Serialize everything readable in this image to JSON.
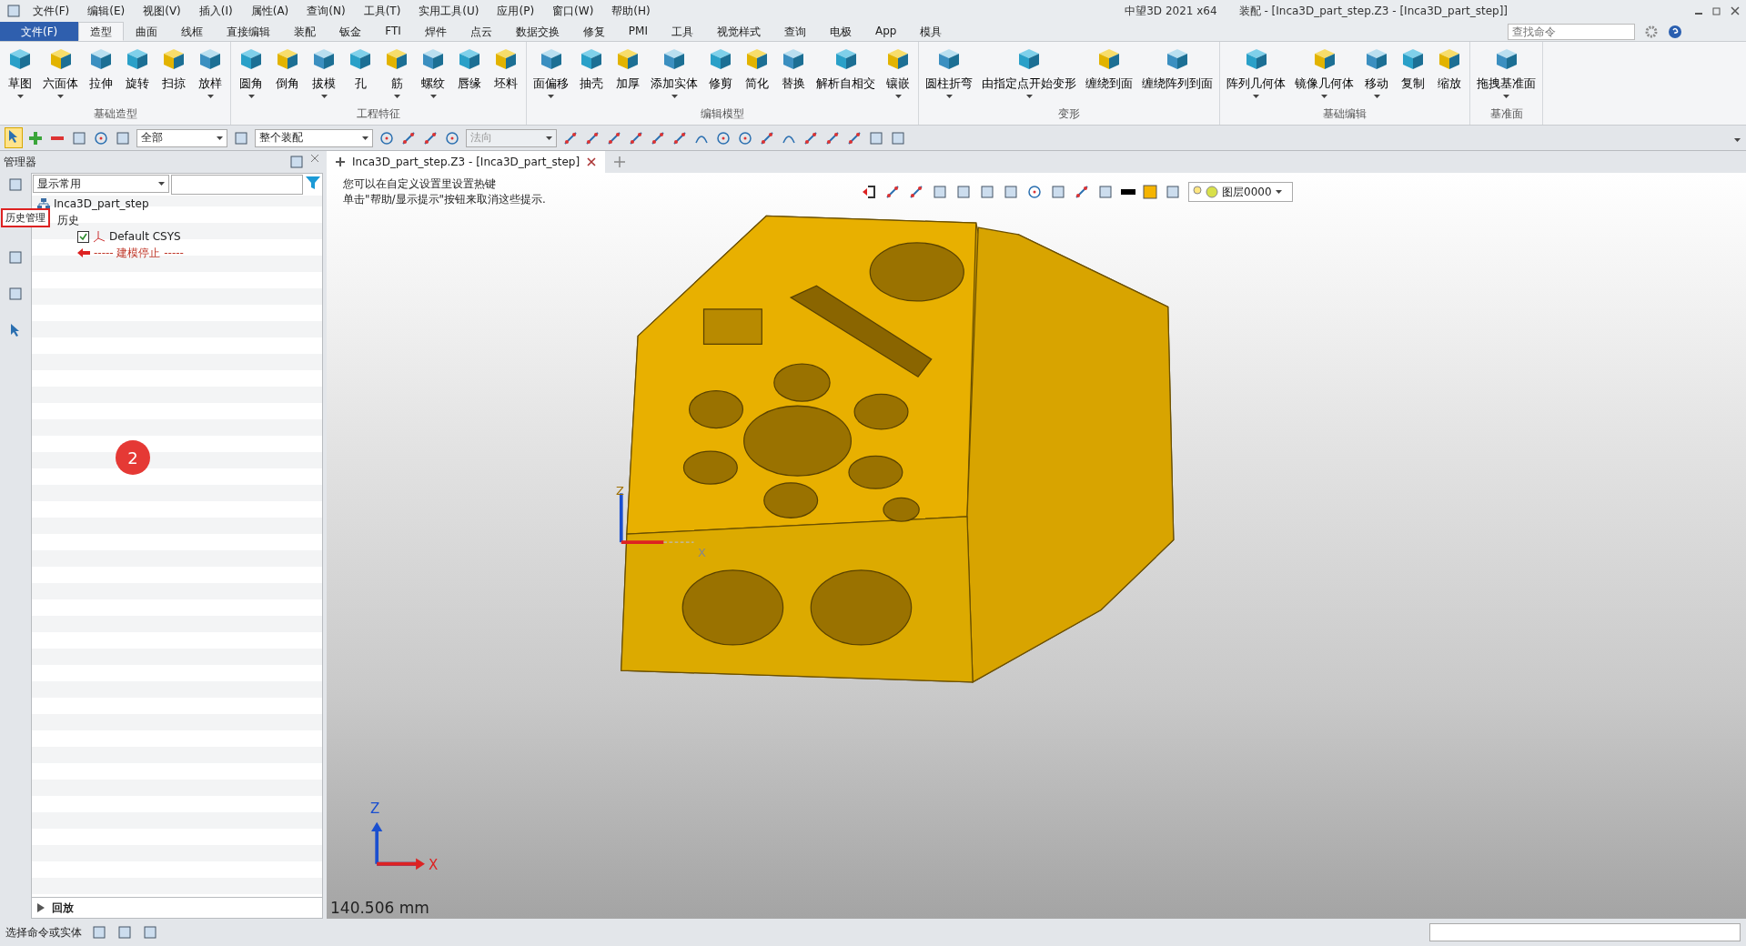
{
  "title_bar": {
    "app_title": "中望3D 2021 x64",
    "document_title": "装配 - [Inca3D_part_step.Z3 - [Inca3D_part_step]]"
  },
  "menu": [
    "文件(F)",
    "编辑(E)",
    "视图(V)",
    "插入(I)",
    "属性(A)",
    "查询(N)",
    "工具(T)",
    "实用工具(U)",
    "应用(P)",
    "窗口(W)",
    "帮助(H)"
  ],
  "search": {
    "placeholder": "查找命令"
  },
  "ribbon_tabs": [
    {
      "label": "文件(F)",
      "kind": "file",
      "selected": false
    },
    {
      "label": "造型",
      "kind": "tab",
      "selected": true
    },
    {
      "label": "曲面",
      "kind": "tab",
      "selected": false
    },
    {
      "label": "线框",
      "kind": "tab",
      "selected": false
    },
    {
      "label": "直接编辑",
      "kind": "tab",
      "selected": false
    },
    {
      "label": "装配",
      "kind": "tab",
      "selected": false
    },
    {
      "label": "钣金",
      "kind": "tab",
      "selected": false
    },
    {
      "label": "FTI",
      "kind": "tab",
      "selected": false
    },
    {
      "label": "焊件",
      "kind": "tab",
      "selected": false
    },
    {
      "label": "点云",
      "kind": "tab",
      "selected": false
    },
    {
      "label": "数据交换",
      "kind": "tab",
      "selected": false
    },
    {
      "label": "修复",
      "kind": "tab",
      "selected": false
    },
    {
      "label": "PMI",
      "kind": "tab",
      "selected": false
    },
    {
      "label": "工具",
      "kind": "tab",
      "selected": false
    },
    {
      "label": "视觉样式",
      "kind": "tab",
      "selected": false
    },
    {
      "label": "查询",
      "kind": "tab",
      "selected": false
    },
    {
      "label": "电极",
      "kind": "tab",
      "selected": false
    },
    {
      "label": "App",
      "kind": "tab",
      "selected": false
    },
    {
      "label": "模具",
      "kind": "tab",
      "selected": false
    }
  ],
  "ribbon_groups": [
    {
      "label": "基础造型",
      "tools": [
        {
          "label": "草图",
          "dropdown": true
        },
        {
          "label": "六面体",
          "dropdown": true
        },
        {
          "label": "拉伸",
          "dropdown": false
        },
        {
          "label": "旋转",
          "dropdown": false
        },
        {
          "label": "扫掠",
          "dropdown": false
        },
        {
          "label": "放样",
          "dropdown": true
        }
      ]
    },
    {
      "label": "工程特征",
      "tools": [
        {
          "label": "圆角",
          "dropdown": true
        },
        {
          "label": "倒角",
          "dropdown": false
        },
        {
          "label": "拔模",
          "dropdown": true
        },
        {
          "label": "孔",
          "dropdown": false
        },
        {
          "label": "筋",
          "dropdown": true
        },
        {
          "label": "螺纹",
          "dropdown": true
        },
        {
          "label": "唇缘",
          "dropdown": false
        },
        {
          "label": "坯料",
          "dropdown": false
        }
      ]
    },
    {
      "label": "编辑模型",
      "tools": [
        {
          "label": "面偏移",
          "dropdown": true
        },
        {
          "label": "抽壳",
          "dropdown": false
        },
        {
          "label": "加厚",
          "dropdown": false
        },
        {
          "label": "添加实体",
          "dropdown": true
        },
        {
          "label": "修剪",
          "dropdown": false
        },
        {
          "label": "简化",
          "dropdown": false
        },
        {
          "label": "替换",
          "dropdown": false
        },
        {
          "label": "解析自相交",
          "dropdown": false
        },
        {
          "label": "镶嵌",
          "dropdown": true
        }
      ]
    },
    {
      "label": "变形",
      "tools": [
        {
          "label": "圆柱折弯",
          "dropdown": true
        },
        {
          "label": "由指定点开始变形",
          "dropdown": true
        },
        {
          "label": "缠绕到面",
          "dropdown": false
        },
        {
          "label": "缠绕阵列到面",
          "dropdown": false
        }
      ]
    },
    {
      "label": "基础编辑",
      "tools": [
        {
          "label": "阵列几何体",
          "dropdown": true
        },
        {
          "label": "镜像几何体",
          "dropdown": true
        },
        {
          "label": "移动",
          "dropdown": true
        },
        {
          "label": "复制",
          "dropdown": false
        },
        {
          "label": "缩放",
          "dropdown": false
        }
      ]
    },
    {
      "label": "基准面",
      "tools": [
        {
          "label": "拖拽基准面",
          "dropdown": true
        }
      ]
    }
  ],
  "toolbar": {
    "filter": "全部",
    "scope": "整个装配",
    "direction": {
      "value": "法向",
      "disabled": true
    }
  },
  "manager": {
    "title": "管理器",
    "display_filter": "显示常用",
    "tree": [
      {
        "label": "Inca3D_part_step",
        "kind": "assembly",
        "children": [
          {
            "label": "历史",
            "children": [
              {
                "label": "Default CSYS",
                "kind": "csys",
                "checked": true
              },
              {
                "label": "----- 建模停止 -----",
                "kind": "stop"
              }
            ]
          }
        ]
      }
    ],
    "tooltip": "历史管理",
    "playback": {
      "label": "回放",
      "expanded": false
    }
  },
  "doc_tabs": [
    {
      "label": "Inca3D_part_step.Z3 - [Inca3D_part_step]",
      "selected": true
    }
  ],
  "hints": [
    "您可以在自定义设置里设置热键",
    "单击\"帮助/显示提示\"按钮来取消这些提示."
  ],
  "view_toolbar": {
    "layer": "图层0000"
  },
  "viewport": {
    "measurement": "140.506 mm",
    "triad": {
      "z": "Z",
      "x": "X"
    },
    "model_csys": {
      "z": "Z",
      "x": "X"
    }
  },
  "step_badge": "2",
  "status_bar": {
    "prompt": "选择命令或实体"
  }
}
